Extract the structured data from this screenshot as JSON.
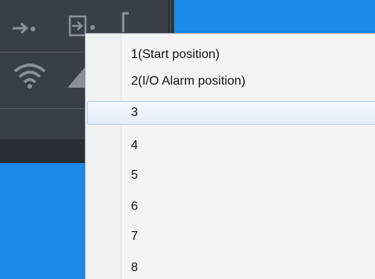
{
  "toolbar": {
    "icons": [
      "arrow-right-dot-icon",
      "enter-box-icon",
      "bracket-icon",
      "wifi-icon",
      "triangle-icon"
    ]
  },
  "menu": {
    "items": [
      {
        "label": "1(Start position)"
      },
      {
        "label": "2(I/O Alarm position)"
      },
      {
        "label": "3",
        "highlighted": true
      },
      {
        "label": "4"
      },
      {
        "label": "5"
      },
      {
        "label": "6"
      },
      {
        "label": "7"
      },
      {
        "label": "8"
      }
    ]
  },
  "colors": {
    "desktop": "#1a8be8",
    "toolbar": "#3a3f45",
    "menu_bg": "#f4f4f4",
    "highlight_border": "#aecbf1"
  }
}
